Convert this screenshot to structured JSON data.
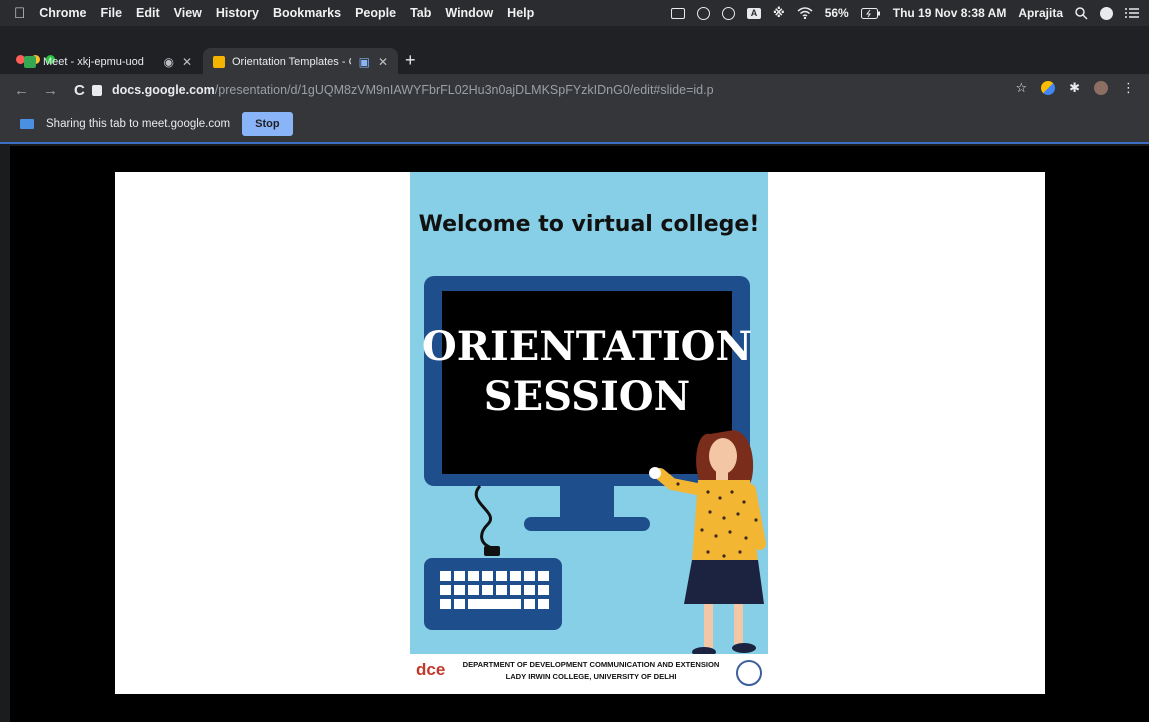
{
  "menubar": {
    "app_name": "Chrome",
    "menus": [
      "File",
      "Edit",
      "View",
      "History",
      "Bookmarks",
      "People",
      "Tab",
      "Window",
      "Help"
    ],
    "battery": "56%",
    "datetime": "Thu 19 Nov  8:38 AM",
    "user": "Aprajita"
  },
  "tabs": [
    {
      "title": "Meet - xkj-epmu-uod",
      "favicon": "meet-icon",
      "color": "#f4b400"
    },
    {
      "title": "Orientation Templates - Go",
      "favicon": "slides-icon",
      "color": "#f4b400"
    }
  ],
  "address": {
    "host": "docs.google.com",
    "path": "/presentation/d/1gUQM8zVM9nIAWYFbrFL02Hu3n0ajDLMKSpFYzkIDnG0/edit#slide=id.p"
  },
  "sharing": {
    "message": "Sharing this tab to meet.google.com",
    "stop_label": "Stop"
  },
  "slide": {
    "welcome": "Welcome to virtual college!",
    "screen_line1": "ORIENTATION",
    "screen_line2": "SESSION",
    "logo_text": "dce",
    "dept_line1": "DEPARTMENT OF DEVELOPMENT COMMUNICATION AND EXTENSION",
    "dept_line2": "LADY IRWIN COLLEGE, UNIVERSITY OF DELHI"
  },
  "colors": {
    "poster_bg": "#87cfe6",
    "monitor": "#1f4e8c",
    "accent_blue": "#8ab4f8",
    "dress": "#f2b632"
  }
}
